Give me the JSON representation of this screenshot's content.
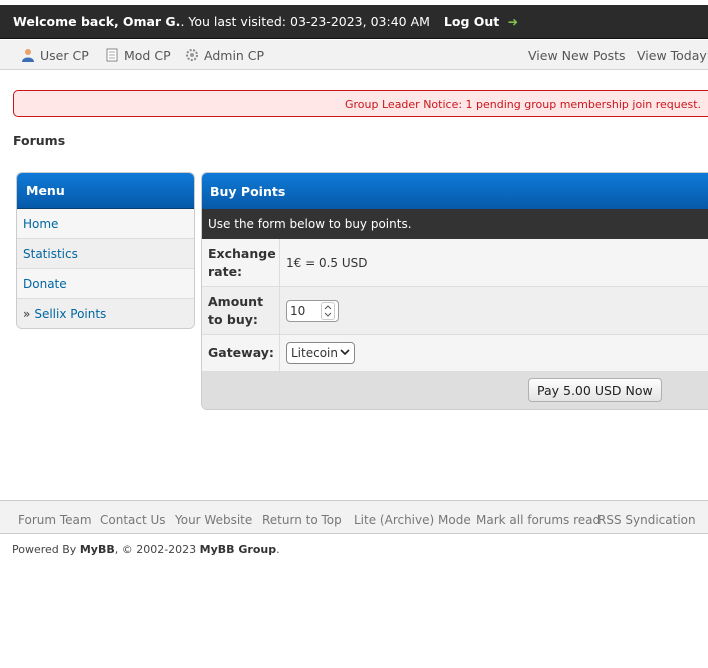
{
  "header": {
    "welcome_prefix": "Welcome back, ",
    "username": "Omar G.",
    "last_visited": ". You last visited: 03-23-2023, 03:40 AM",
    "logout_label": "Log Out",
    "logout_arrow": "➜"
  },
  "panel_nav": {
    "user_cp": "User CP",
    "mod_cp": "Mod CP",
    "admin_cp": "Admin CP",
    "view_new_posts": "View New Posts",
    "view_todays": "View Today's Posts"
  },
  "notice": "Group Leader Notice: 1 pending group membership join request.",
  "breadcrumb": "Forums",
  "menu": {
    "title": "Menu",
    "items": [
      {
        "label": "Home"
      },
      {
        "label": "Statistics"
      },
      {
        "label": "Donate"
      },
      {
        "prefix": "»",
        "label": "Sellix Points"
      }
    ]
  },
  "buy_points": {
    "title": "Buy Points",
    "subtitle": "Use the form below to buy points.",
    "exchange_label_1": "Exchange",
    "exchange_label_2": "rate:",
    "exchange_value": "1€ = 0.5 USD",
    "amount_label_1": "Amount",
    "amount_label_2": "to buy:",
    "amount_value": "10",
    "gateway_label": "Gateway:",
    "gateway_value": "Litecoin",
    "pay_button": "Pay 5.00 USD Now"
  },
  "footer_links": [
    "Forum Team",
    "Contact Us",
    "Your Website",
    "Return to Top",
    "Lite (Archive) Mode",
    "Mark all forums read",
    "RSS Syndication"
  ],
  "powered": {
    "prefix": "Powered By ",
    "mybb": "MyBB",
    "middle": ", © 2002-2023 ",
    "group": "MyBB Group",
    "suffix": "."
  },
  "colors": {
    "header_bg": "#2b2b2b",
    "accent_blue": "#0f7ad8",
    "link": "#0066a2",
    "notice_red": "#c9151b",
    "notice_bg": "#ffe7e8"
  }
}
